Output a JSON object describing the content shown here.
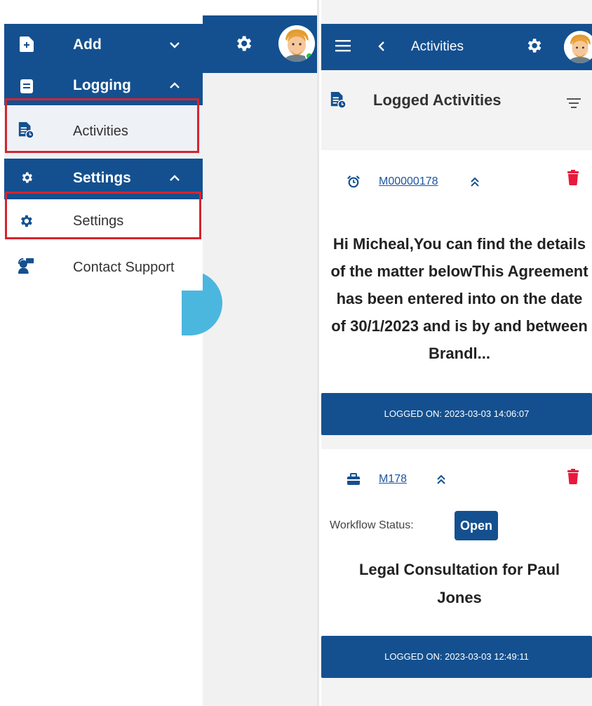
{
  "sidebar": {
    "add": {
      "label": "Add",
      "icon": "file-plus-icon"
    },
    "logging": {
      "label": "Logging",
      "icon": "document-icon"
    },
    "activities": {
      "label": "Activities",
      "icon": "document-clock-icon"
    },
    "settings_section": {
      "label": "Settings",
      "icon": "gear-icon"
    },
    "settings": {
      "label": "Settings",
      "icon": "gear-icon"
    },
    "contact_support": {
      "label": "Contact Support",
      "icon": "support-headset-icon"
    }
  },
  "mobile": {
    "appbar": {
      "title": "Activities"
    },
    "page_title": "Logged Activities",
    "cards": [
      {
        "matter_link": "M00000178",
        "type_icon": "alarm-clock-icon",
        "body": "Hi Micheal,You can find the details of the matter belowThis Agreement has been entered into on the date of 30/1/2023 and is by and between Brandl...",
        "footer": "LOGGED ON: 2023-03-03 14:06:07"
      },
      {
        "matter_link": "M178",
        "type_icon": "briefcase-icon",
        "workflow_label": "Workflow Status:",
        "workflow_status": "Open",
        "body": "Legal Consultation for Paul Jones",
        "footer": "LOGGED ON: 2023-03-03 12:49:11"
      }
    ]
  },
  "colors": {
    "primary": "#14508f",
    "highlight": "#d6242d",
    "delete": "#e8193c",
    "online": "#25c14a",
    "fab": "#4bb7df"
  }
}
